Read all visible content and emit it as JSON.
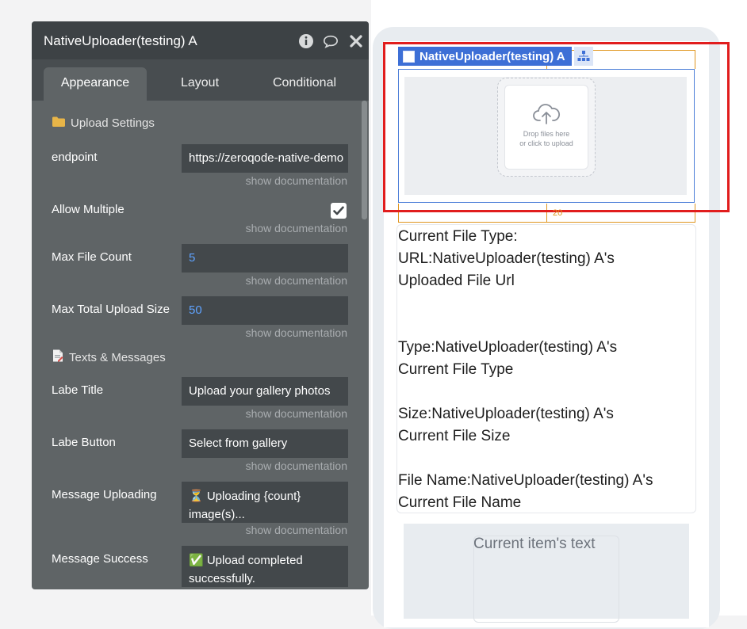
{
  "panel": {
    "title": "NativeUploader(testing) A",
    "header_icons": [
      "info-icon",
      "comment-icon",
      "close-icon"
    ],
    "tabs": [
      {
        "label": "Appearance",
        "active": true
      },
      {
        "label": "Layout",
        "active": false
      },
      {
        "label": "Conditional",
        "active": false
      }
    ],
    "doc_link": "show documentation",
    "sections": {
      "upload_settings": "Upload Settings",
      "texts_messages": "Texts & Messages"
    },
    "fields": {
      "endpoint": {
        "label": "endpoint",
        "value": "https://zeroqode-native-demo"
      },
      "allow_multiple": {
        "label": "Allow Multiple",
        "checked": true
      },
      "max_file_count": {
        "label": "Max File Count",
        "value": "5"
      },
      "max_total_upload_size": {
        "label": "Max Total Upload Size",
        "value": "50"
      },
      "labe_title": {
        "label": "Labe Title",
        "value": "Upload your gallery photos"
      },
      "labe_button": {
        "label": "Labe Button",
        "value": "Select from gallery"
      },
      "message_uploading": {
        "label": "Message Uploading",
        "value": "⏳ Uploading {count} image(s)..."
      },
      "message_success": {
        "label": "Message Success",
        "value": "✅ Upload completed successfully."
      }
    }
  },
  "canvas": {
    "element_tag": "NativeUploader(testing) A",
    "margin_bottom": "20",
    "dropzone": {
      "line1": "Drop files here",
      "line2": "or click to upload"
    },
    "text_lines": [
      "Current File Type:",
      "URL:NativeUploader(testing) A's",
      "Uploaded File Url",
      "Type:NativeUploader(testing) A's",
      "Current File Type",
      "Size:NativeUploader(testing) A's",
      "Current File Size",
      "File Name:NativeUploader(testing) A's",
      "Current File Name"
    ],
    "item_text": "Current item's text"
  },
  "colors": {
    "panel_bg": "#5f6466",
    "panel_header": "#3d4245",
    "selection_blue": "#3d6fd6",
    "highlight_red": "#e11d1d",
    "margin_orange": "#e0961f"
  }
}
